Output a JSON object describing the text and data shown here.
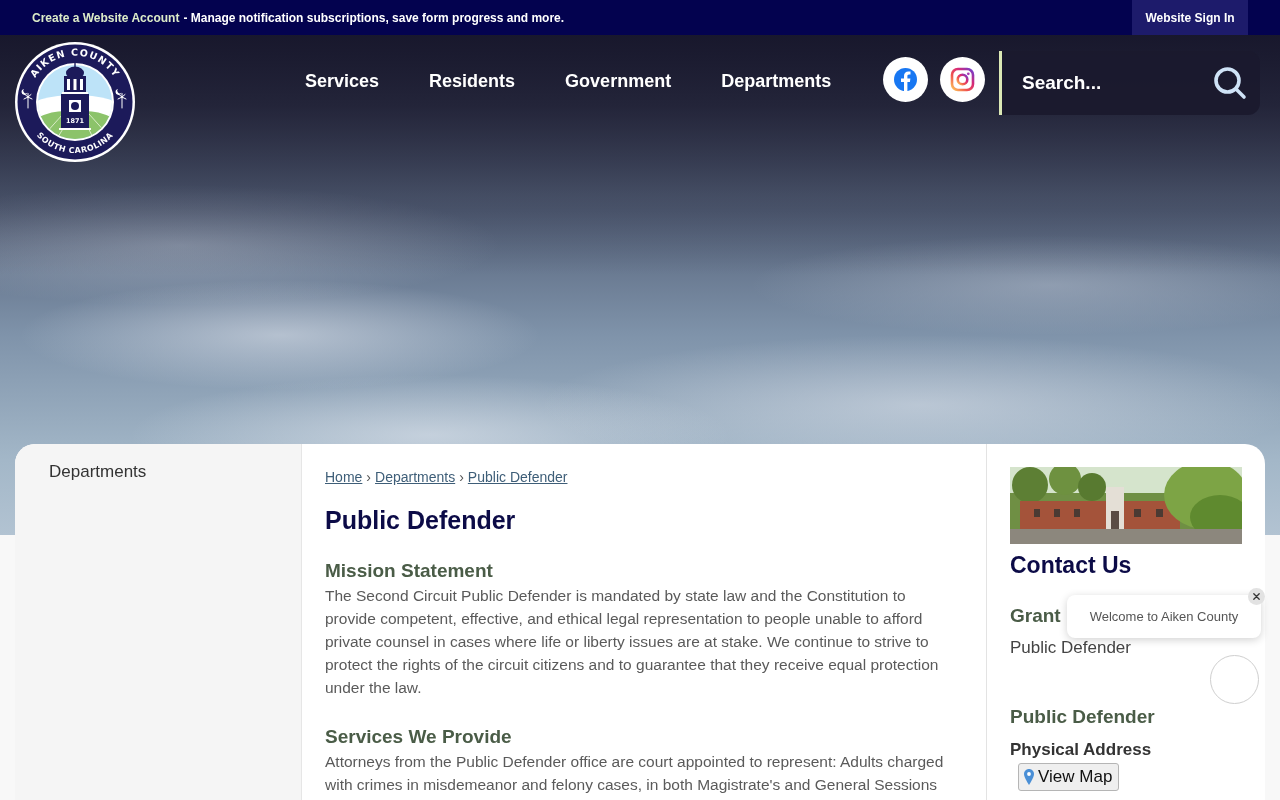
{
  "top_bar": {
    "account_link": "Create a Website Account",
    "message": "- Manage notification subscriptions, save form progress and more.",
    "sign_in": "Website Sign In"
  },
  "header": {
    "logo": {
      "top_text": "AIKEN COUNTY",
      "year": "1871",
      "bottom_text": "SOUTH CAROLINA"
    },
    "nav": [
      {
        "label": "Services"
      },
      {
        "label": "Residents"
      },
      {
        "label": "Government"
      },
      {
        "label": "Departments"
      }
    ],
    "social": [
      {
        "kind": "facebook"
      },
      {
        "kind": "instagram"
      }
    ],
    "search": {
      "placeholder": "Search..."
    }
  },
  "sidebar": {
    "items": [
      {
        "label": "Departments"
      }
    ]
  },
  "breadcrumb": {
    "items": [
      {
        "label": "Home"
      },
      {
        "label": "Departments"
      },
      {
        "label": "Public Defender"
      }
    ],
    "separators": [
      "›",
      "›"
    ]
  },
  "page_title": "Public Defender",
  "sections": [
    {
      "heading": "Mission Statement",
      "text": "The Second Circuit Public Defender is mandated by state law and the Constitution to provide competent, effective, and ethical legal representation to people unable to afford private counsel in cases where life or liberty issues are at stake. We continue to strive to protect the rights of the circuit citizens and to guarantee that they receive equal protection under the law."
    },
    {
      "heading": "Services We Provide",
      "text": "Attorneys from the Public Defender office are court appointed to represent: Adults charged with crimes in misdemeanor and felony cases, in both Magistrate's and General Sessions"
    }
  ],
  "contact": {
    "title": "Contact Us",
    "groups": [
      {
        "heading": "Grant",
        "text": "Public Defender"
      },
      {
        "heading": "Public Defender",
        "label": "Physical Address",
        "map_button": "View Map"
      }
    ]
  },
  "welcome_popup": {
    "message": "Welcome to Aiken County"
  }
}
